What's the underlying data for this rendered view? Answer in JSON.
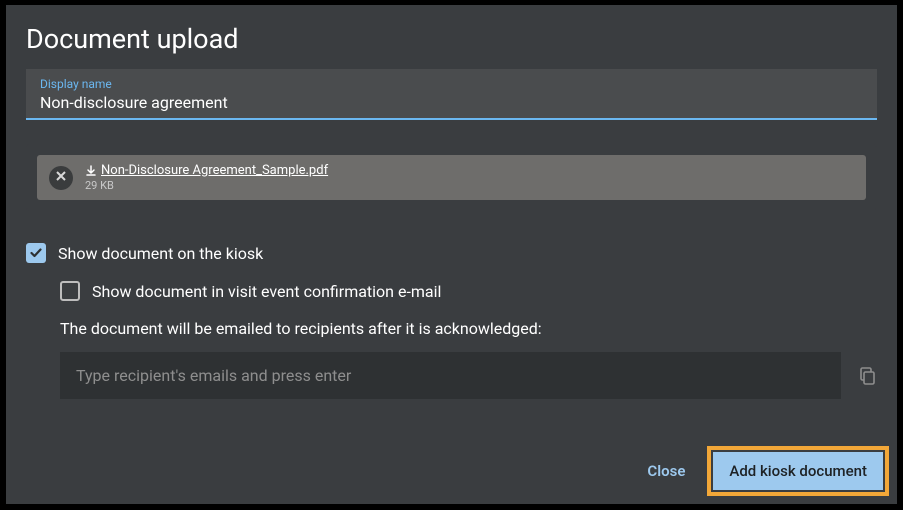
{
  "dialog": {
    "title": "Document upload",
    "display_name": {
      "label": "Display name",
      "value": "Non-disclosure agreement"
    },
    "file": {
      "name": "Non-Disclosure Agreement_Sample.pdf",
      "size": "29 KB",
      "remove_icon": "close-icon",
      "download_icon": "download-icon"
    },
    "checkbox_kiosk": {
      "label": "Show document on the kiosk",
      "checked": true
    },
    "checkbox_email": {
      "label": "Show document in visit event confirmation e-mail",
      "checked": false
    },
    "recipients": {
      "label": "The document will be emailed to recipients after it is acknowledged:",
      "placeholder": "Type recipient's emails and press enter",
      "copy_icon": "copy-icon"
    },
    "buttons": {
      "close": "Close",
      "add": "Add kiosk document"
    }
  },
  "colors": {
    "accent": "#9dc9ee",
    "highlight": "#f2a738"
  }
}
